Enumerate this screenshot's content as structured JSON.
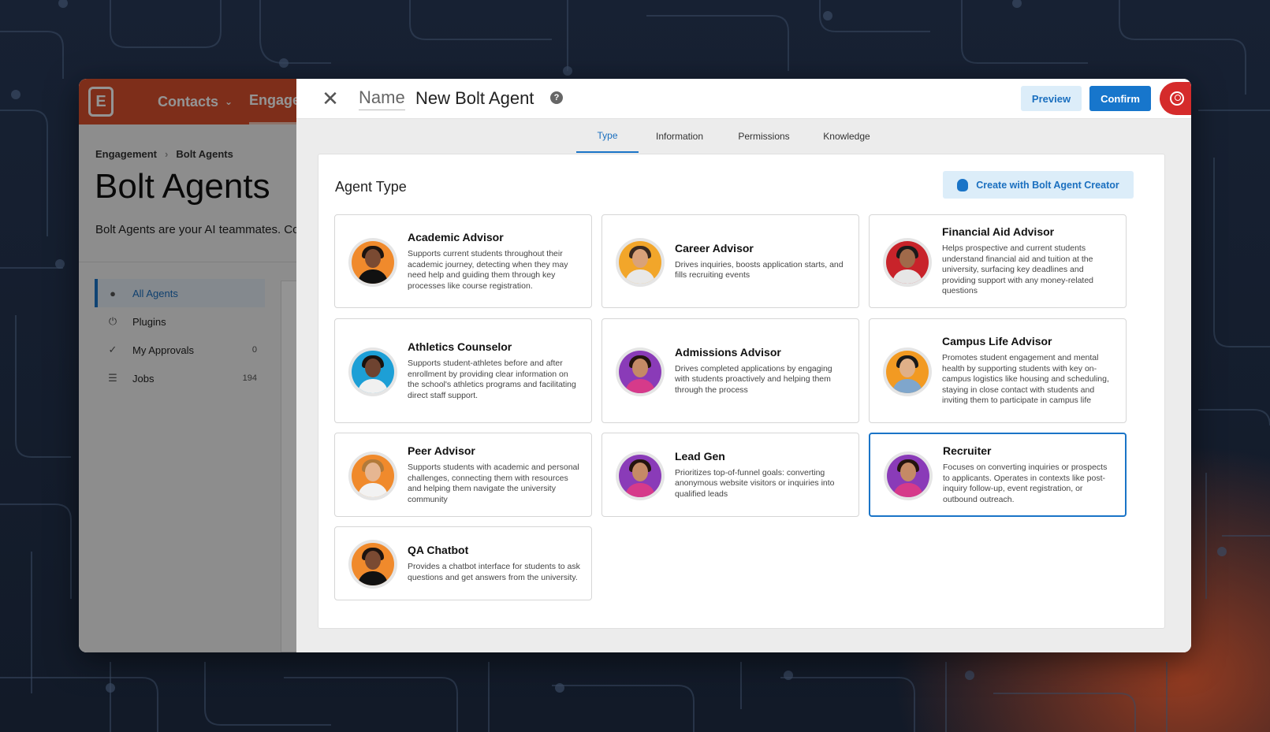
{
  "app": {
    "nav": {
      "contacts": "Contacts",
      "engagement": "Engage"
    },
    "breadcrumb": {
      "root": "Engagement",
      "current": "Bolt Agents"
    },
    "page_title": "Bolt Agents",
    "page_description": "Bolt Agents are your AI teammates. Cor",
    "sidebar": [
      {
        "label": "All Agents",
        "icon": "person-icon",
        "count": ""
      },
      {
        "label": "Plugins",
        "icon": "plug-icon",
        "count": ""
      },
      {
        "label": "My Approvals",
        "icon": "check-icon",
        "count": "0"
      },
      {
        "label": "Jobs",
        "icon": "clipboard-icon",
        "count": "194"
      }
    ]
  },
  "modal": {
    "name_label": "Name",
    "name_value": "New Bolt Agent",
    "preview_label": "Preview",
    "confirm_label": "Confirm",
    "tabs": [
      "Type",
      "Information",
      "Permissions",
      "Knowledge"
    ],
    "active_tab": "Type",
    "section_title": "Agent Type",
    "creator_button": "Create with Bolt Agent Creator",
    "agents": [
      {
        "name": "Academic Advisor",
        "description": "Supports current students throughout their academic journey, detecting when they may need help and guiding them through key processes like course registration.",
        "bg": "#f08a2c",
        "skin": "#7a4a32",
        "hair": "#1c1410",
        "shirt": "#111111"
      },
      {
        "name": "Career Advisor",
        "description": "Drives inquiries, boosts application starts, and fills recruiting events",
        "bg": "#f2a62a",
        "skin": "#d9a27a",
        "hair": "#3a2a20",
        "shirt": "#e8e8e8"
      },
      {
        "name": "Financial Aid Advisor",
        "description": "Helps prospective and current students understand financial aid and tuition at the university, surfacing key deadlines and providing support with any money-related questions",
        "bg": "#c8232a",
        "skin": "#a06a4a",
        "hair": "#1a1a1a",
        "shirt": "#e6e6e6"
      },
      {
        "name": "Athletics Counselor",
        "description": "Supports student-athletes before and after enrollment by providing clear information on the school's athletics programs and facilitating direct staff support.",
        "bg": "#1d9fd6",
        "skin": "#6e4330",
        "hair": "#1a120e",
        "shirt": "#f0f0f0"
      },
      {
        "name": "Admissions Advisor",
        "description": "Drives completed applications by engaging with students proactively and helping them through the process",
        "bg": "#8a3bb8",
        "skin": "#c58a66",
        "hair": "#24140e",
        "shirt": "#d63a8a"
      },
      {
        "name": "Campus Life Advisor",
        "description": "Promotes student engagement and mental health by supporting students with key on-campus logistics like housing and scheduling, staying in close contact with students and inviting them to participate in campus life",
        "bg": "#f29a22",
        "skin": "#e0b088",
        "hair": "#1a1a1a",
        "shirt": "#7fa6cc"
      },
      {
        "name": "Peer Advisor",
        "description": "Supports students with academic and personal challenges, connecting them with resources and helping them navigate the university community",
        "bg": "#f08a2c",
        "skin": "#e6b692",
        "hair": "#b27a3a",
        "shirt": "#f2f2f2"
      },
      {
        "name": "Lead Gen",
        "description": "Prioritizes top-of-funnel goals: converting anonymous website visitors or inquiries into qualified leads",
        "bg": "#8a3bb8",
        "skin": "#c58a66",
        "hair": "#24140e",
        "shirt": "#d63a8a"
      },
      {
        "name": "Recruiter",
        "description": "Focuses on converting inquiries or prospects to applicants. Operates in contexts like post-inquiry follow-up, event registration, or outbound outreach.",
        "bg": "#8a3bb8",
        "skin": "#c58a66",
        "hair": "#24140e",
        "shirt": "#d63a8a",
        "selected": true
      },
      {
        "name": "QA Chatbot",
        "description": "Provides a chatbot interface for students to ask questions and get answers from the university.",
        "bg": "#f08a2c",
        "skin": "#7a4a32",
        "hair": "#1c1410",
        "shirt": "#111111"
      }
    ]
  },
  "colors": {
    "brand": "#d9502e",
    "accent": "#1a74c7",
    "avatar_button": "#d52b2b"
  }
}
